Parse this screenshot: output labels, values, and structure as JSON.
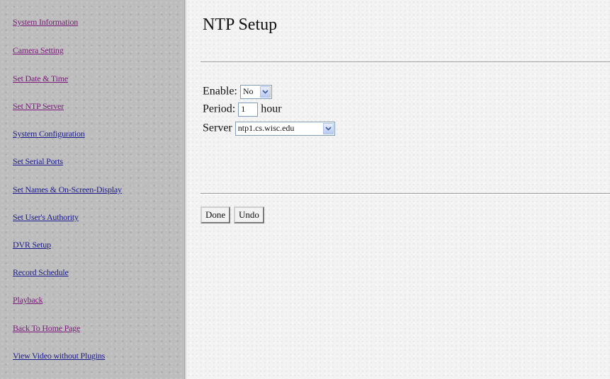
{
  "nav": {
    "items": [
      {
        "label": "System Information"
      },
      {
        "label": "Camera Setting"
      },
      {
        "label": "Set Date & Time"
      },
      {
        "label": "Set NTP Server"
      },
      {
        "label": "System Configuration"
      },
      {
        "label": "Set Serial Ports"
      },
      {
        "label": "Set Names & On-Screen-Display"
      },
      {
        "label": "Set User's Authority"
      },
      {
        "label": "DVR Setup"
      },
      {
        "label": "Record Schedule"
      },
      {
        "label": "Playback"
      },
      {
        "label": "Back To Home Page"
      },
      {
        "label": "View Video without Plugins"
      }
    ]
  },
  "page": {
    "title": "NTP Setup"
  },
  "form": {
    "enable": {
      "label": "Enable:",
      "value": "No"
    },
    "period": {
      "label": "Period:",
      "value": "1",
      "unit": "hour"
    },
    "server": {
      "label": "Server",
      "value": "ntp1.cs.wisc.edu"
    }
  },
  "buttons": {
    "done": "Done",
    "undo": "Undo"
  },
  "colors": {
    "link": "#1a1a8c",
    "visited_link": "#7a1a7a",
    "sidebar_bg": "#bdbdbd"
  }
}
